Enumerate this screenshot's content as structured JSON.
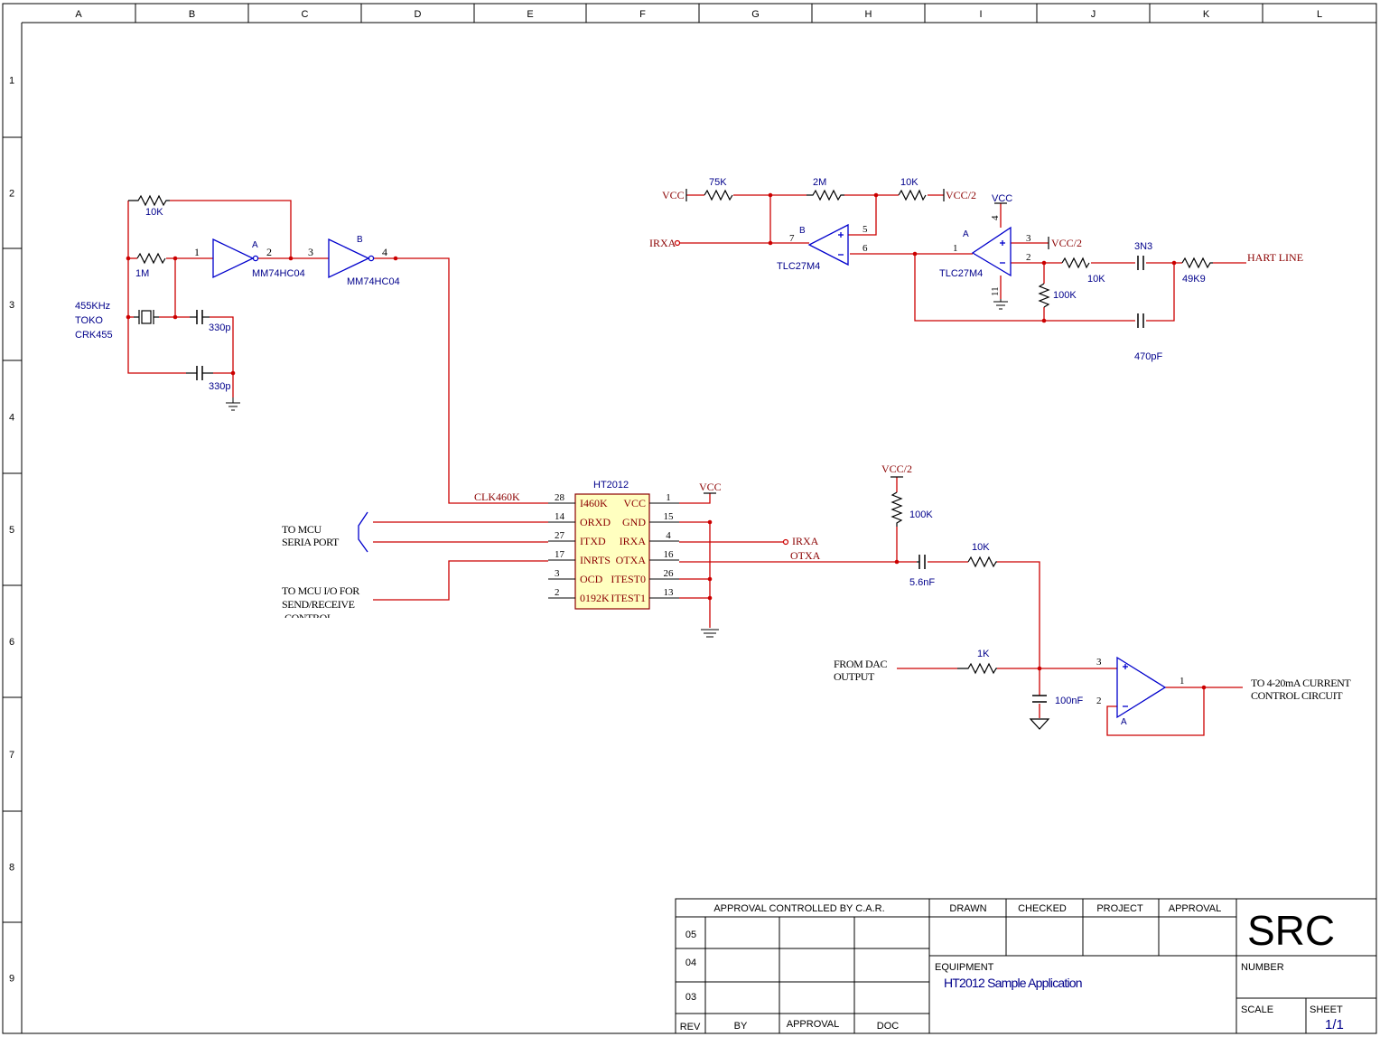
{
  "frame": {
    "columns": [
      "A",
      "B",
      "C",
      "D",
      "E",
      "F",
      "G",
      "H",
      "I",
      "J",
      "K",
      "L"
    ],
    "rows": [
      "1",
      "2",
      "3",
      "4",
      "5",
      "6",
      "7",
      "8",
      "9"
    ]
  },
  "oscillator": {
    "res_feedback": "10K",
    "res_bias": "1M",
    "crystal_freq": "455KHz",
    "crystal_brand": "TOKO",
    "crystal_part": "CRK455",
    "cap_top": "330p",
    "cap_bottom": "330p",
    "inv_a_unit": "A",
    "inv_a_part": "MM74HC04",
    "inv_a_pin_in": "1",
    "inv_a_pin_out": "2",
    "inv_b_unit": "B",
    "inv_b_part": "MM74HC04",
    "inv_b_pin_in": "3",
    "inv_b_pin_out": "4"
  },
  "receiver": {
    "vcc_label": "VCC",
    "r1": "75K",
    "r2": "2M",
    "r3": "10K",
    "vcc_half": "VCC/2",
    "irxa_label": "IRXA",
    "opamp_b_unit": "B",
    "opamp_b_part": "TLC27M4",
    "opamp_b_pin5": "5",
    "opamp_b_pin6": "6",
    "opamp_b_pin7": "7",
    "opamp_a_unit": "A",
    "opamp_a_part": "TLC27M4",
    "opamp_a_pin1": "1",
    "opamp_a_pin2": "2",
    "opamp_a_pin3": "3",
    "opamp_a_pin4": "4",
    "opamp_a_pin11": "11",
    "opamp_a_vcc": "VCC",
    "opamp_a_pin3_ref": "VCC/2",
    "c1": "3N3",
    "r4": "10K",
    "r5": "49K9",
    "r6": "100K",
    "c2": "470pF",
    "hart": "HART LINE"
  },
  "ic": {
    "title": "HT2012",
    "left_pins": [
      {
        "num": "28",
        "name": "I460K"
      },
      {
        "num": "14",
        "name": "ORXD"
      },
      {
        "num": "27",
        "name": "ITXD"
      },
      {
        "num": "17",
        "name": "INRTS"
      },
      {
        "num": "3",
        "name": "OCD"
      },
      {
        "num": "2",
        "name": "0192K"
      }
    ],
    "right_pins": [
      {
        "num": "1",
        "name": "VCC"
      },
      {
        "num": "15",
        "name": "GND"
      },
      {
        "num": "4",
        "name": "IRXA"
      },
      {
        "num": "16",
        "name": "OTXA"
      },
      {
        "num": "26",
        "name": "ITEST0"
      },
      {
        "num": "13",
        "name": "ITEST1"
      }
    ],
    "clk_net": "CLK460K",
    "vcc_net": "VCC",
    "irxa_net": "IRXA",
    "otxa_net": "OTXA",
    "mcu_serial_1": "TO MCU",
    "mcu_serial_2": "SERIA PORT",
    "mcu_io_1": "TO MCU I/O FOR",
    "mcu_io_2": "SEND/RECEIVE",
    "mcu_io_3": "CONTROL"
  },
  "transmit": {
    "vcc_half": "VCC/2",
    "r_pull": "100K",
    "c_couple": "5.6nF",
    "r_series": "10K",
    "r_dac": "1K",
    "c_filter": "100nF",
    "dac_1": "FROM DAC",
    "dac_2": "OUTPUT",
    "buf_pin3": "3",
    "buf_pin2": "2",
    "buf_pin1": "1",
    "buf_unit": "A",
    "out_1": "TO 4-20mA CURRENT",
    "out_2": "CONTROL CIRCUIT"
  },
  "title_block": {
    "approval_controlled": "APPROVAL CONTROLLED BY C.A.R.",
    "rev_rows": [
      "05",
      "04",
      "03"
    ],
    "rev": "REV",
    "by": "BY",
    "approval_col": "APPROVAL",
    "doc": "DOC",
    "drawn": "DRAWN",
    "checked": "CHECKED",
    "project": "PROJECT",
    "approval": "APPROVAL",
    "company": "SRC",
    "equipment_label": "EQUIPMENT",
    "equipment_value": "HT2012 Sample Application",
    "number_label": "NUMBER",
    "scale_label": "SCALE",
    "sheet_label": "SHEET",
    "sheet_value": "1/1"
  }
}
